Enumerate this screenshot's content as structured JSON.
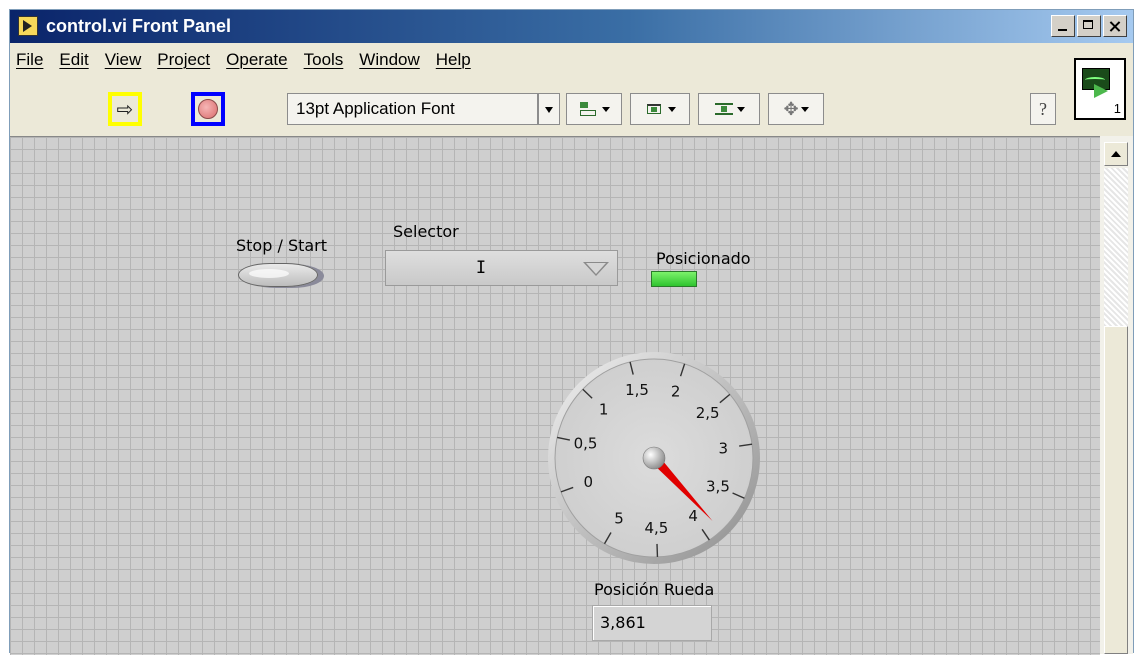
{
  "window": {
    "title": "control.vi Front Panel"
  },
  "menu": {
    "items": [
      "File",
      "Edit",
      "View",
      "Project",
      "Operate",
      "Tools",
      "Window",
      "Help"
    ]
  },
  "toolbar": {
    "font_selector": "13pt Application Font",
    "help_glyph": "?",
    "run_icon": "run-arrow-icon",
    "stop_icon": "abort-execution-icon",
    "run_highlight_color": "#ffff00",
    "stop_highlight_color": "#0000ff"
  },
  "vi_icon": {
    "number": "1"
  },
  "panel": {
    "stop_start": {
      "label": "Stop / Start"
    },
    "selector": {
      "label": "Selector",
      "value": "I"
    },
    "posicionado": {
      "label": "Posicionado",
      "state": "on",
      "color": "#3ddc3d"
    },
    "gauge": {
      "label": "Posición Rueda",
      "min": 0,
      "max": 5,
      "value": 3.861,
      "display_value": "3,861",
      "tick_labels": [
        "0",
        "0,5",
        "1",
        "1,5",
        "2",
        "2,5",
        "3",
        "3,5",
        "4",
        "4,5",
        "5"
      ],
      "needle_color": "#e00000"
    }
  }
}
